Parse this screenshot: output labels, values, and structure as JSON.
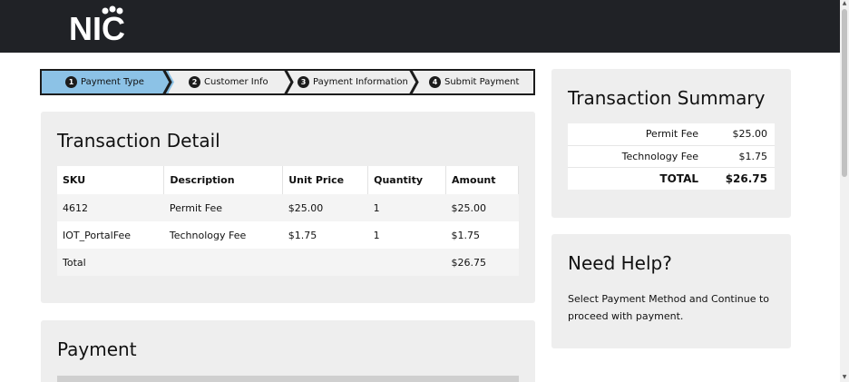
{
  "header": {
    "logo_text": "NIC",
    "background": "#202226"
  },
  "stepper": {
    "steps": [
      {
        "number": "1",
        "label": "Payment Type",
        "active": true
      },
      {
        "number": "2",
        "label": "Customer Info",
        "active": false
      },
      {
        "number": "3",
        "label": "Payment Information",
        "active": false
      },
      {
        "number": "4",
        "label": "Submit Payment",
        "active": false
      }
    ],
    "active_color": "#8cc2e6"
  },
  "transaction_detail": {
    "title": "Transaction Detail",
    "columns": [
      "SKU",
      "Description",
      "Unit Price",
      "Quantity",
      "Amount"
    ],
    "rows": [
      [
        "4612",
        "Permit Fee",
        "$25.00",
        "1",
        "$25.00"
      ],
      [
        "IOT_PortalFee",
        "Technology Fee",
        "$1.75",
        "1",
        "$1.75"
      ]
    ],
    "total_label": "Total",
    "total_amount": "$26.75"
  },
  "payment": {
    "title": "Payment"
  },
  "transaction_summary": {
    "title": "Transaction Summary",
    "items": [
      {
        "label": "Permit Fee",
        "amount": "$25.00"
      },
      {
        "label": "Technology Fee",
        "amount": "$1.75"
      }
    ],
    "total_label": "TOTAL",
    "total_amount": "$26.75"
  },
  "help": {
    "title": "Need Help?",
    "text": "Select Payment Method and Continue to proceed with payment."
  },
  "icons": [
    "chevron-right-icon",
    "scroll-up-icon",
    "scroll-down-icon"
  ]
}
